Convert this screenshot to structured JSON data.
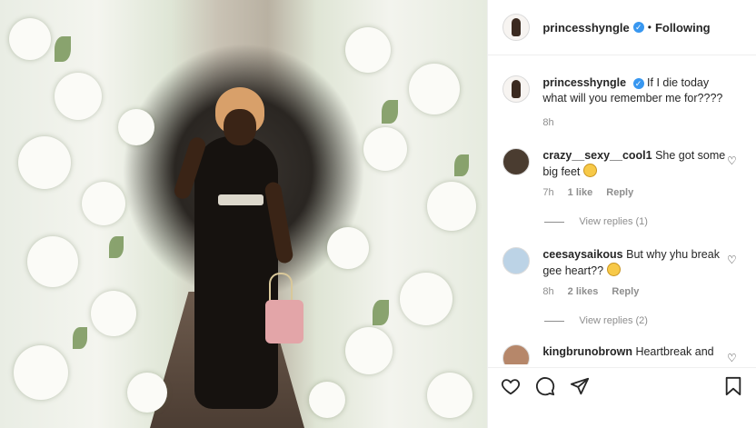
{
  "header": {
    "username": "princesshyngle",
    "separator": "•",
    "follow_label": "Following"
  },
  "caption": {
    "username": "princesshyngle",
    "text": "If I die today what will you remember me for????",
    "time": "8h"
  },
  "comments": [
    {
      "username": "crazy__sexy__cool1",
      "text": "She got some big feet",
      "emoji": "laughing-emoji",
      "time": "7h",
      "likes": "1 like",
      "reply_label": "Reply",
      "view_replies": "View replies (1)"
    },
    {
      "username": "ceesaysaikous",
      "text": "But why yhu break gee heart??",
      "emoji": "pleading-emoji",
      "time": "8h",
      "likes": "2 likes",
      "reply_label": "Reply",
      "view_replies": "View replies (2)"
    },
    {
      "username": "kingbrunobrown",
      "text": "Heartbreak and"
    }
  ],
  "icons": {
    "verified": "verified-badge-icon",
    "like": "heart-icon",
    "comment": "comment-icon",
    "share": "paper-plane-icon",
    "save": "bookmark-icon"
  },
  "colors": {
    "verified": "#3897f0",
    "secondary_text": "#8e8e8e",
    "text": "#262626"
  }
}
